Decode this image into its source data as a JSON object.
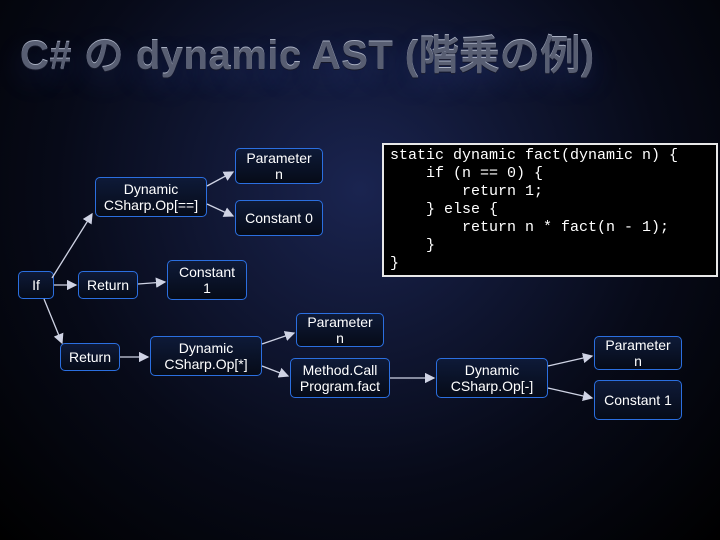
{
  "title": "C# の dynamic  AST (階乗の例)",
  "code": "static dynamic fact(dynamic n) {\n    if (n == 0) {\n        return 1;\n    } else {\n        return n * fact(n - 1);\n    }\n}",
  "nodes": {
    "if": "If",
    "eq": "Dynamic\nCSharp.Op[==]",
    "param_n_1": "Parameter\nn",
    "const_0": "Constant\n0",
    "return_1": "Return",
    "const_1_a": "Constant\n1",
    "return_2": "Return",
    "mul": "Dynamic\nCSharp.Op[*]",
    "param_n_2": "Parameter\nn",
    "call": "Method.Call\nProgram.fact",
    "sub": "Dynamic\nCSharp.Op[-]",
    "param_n_3": "Parameter\nn",
    "const_1_b": "Constant\n1"
  }
}
